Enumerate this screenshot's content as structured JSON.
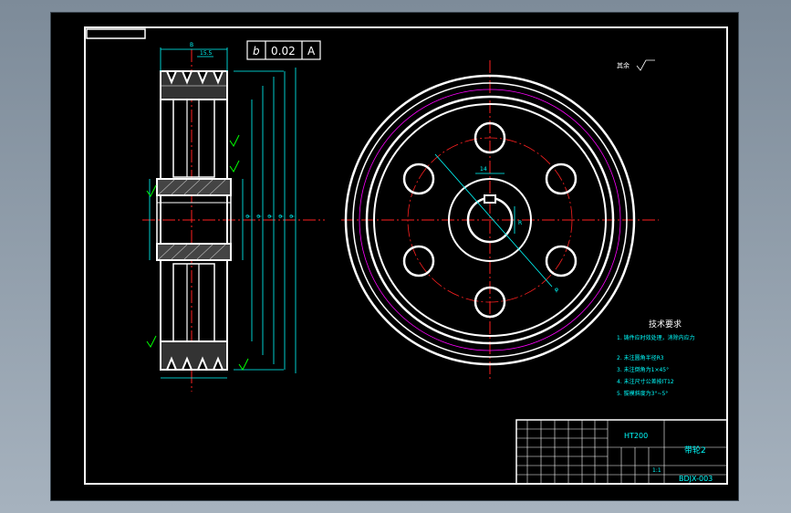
{
  "colors": {
    "background": "#000000",
    "outline": "#ffffff",
    "centerline": "#ff2020",
    "dimension": "#00ffff",
    "pitch_circle": "#ff00ff",
    "roughness": "#00ff00",
    "frame": "#7d8b99"
  },
  "tolerance_frame": {
    "symbol": "b",
    "value": "0.02",
    "datum": "A"
  },
  "roughness_note": "其余",
  "tech_requirements": {
    "title": "技术要求",
    "items": [
      "1. 铸件应时效处理，消除内应力",
      "2. 未注圆角半径R3",
      "3. 未注倒角为1×45°",
      "4. 未注尺寸公差按IT12",
      "5. 拔模斜度为3°~5°"
    ]
  },
  "title_block": {
    "material": "HT200",
    "part_name": "带轮2",
    "drawing_number": "BDJX-003",
    "scale": "1:1"
  }
}
